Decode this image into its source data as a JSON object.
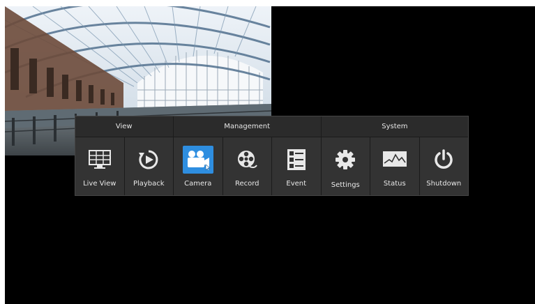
{
  "menu": {
    "groups": [
      {
        "label": "View"
      },
      {
        "label": "Management"
      },
      {
        "label": "System"
      }
    ],
    "items": [
      {
        "label": "Live View",
        "icon": "monitor-grid-icon"
      },
      {
        "label": "Playback",
        "icon": "playback-icon"
      },
      {
        "label": "Camera",
        "icon": "camera-icon",
        "selected": true
      },
      {
        "label": "Record",
        "icon": "film-reel-icon"
      },
      {
        "label": "Event",
        "icon": "event-list-icon"
      },
      {
        "label": "Settings",
        "icon": "gear-icon"
      },
      {
        "label": "Status",
        "icon": "status-chart-icon"
      },
      {
        "label": "Shutdown",
        "icon": "power-icon"
      }
    ]
  },
  "colors": {
    "background": "#000000",
    "menu_panel": "#2b2b2b",
    "selected_accent": "#2e8ee0"
  }
}
